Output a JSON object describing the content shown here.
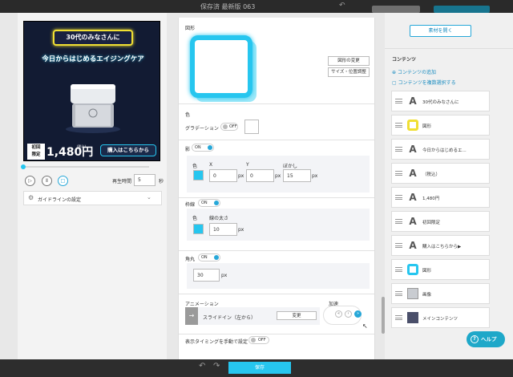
{
  "topbar": {
    "title": "保存済 最新版 063",
    "left_button": "",
    "right_button": ""
  },
  "banner": {
    "headline": "30代のみなさんに",
    "subline": "今日からはじめるエイジングケア",
    "badge_line1": "初回",
    "badge_line2": "限定",
    "price": "1,480円",
    "tax_note": "(税込)",
    "buy_button": "購入はこちらから"
  },
  "preview": {
    "progress": 0.02,
    "play_time_label": "再生時間",
    "play_time_value": "5",
    "play_time_unit": "秒",
    "guideline_label": "ガイドラインの設定"
  },
  "editor": {
    "shape_label": "図形",
    "change_shape": "図形の変更",
    "size_position": "サイズ・位置調整",
    "color_label": "色",
    "gradation_label": "グラデーション",
    "gradation_state": "OFF",
    "shadow_label": "影",
    "shadow_state": "ON",
    "shadow_color_label": "色",
    "shadow_x_label": "X",
    "shadow_y_label": "Y",
    "shadow_blur_label": "ぼかし",
    "shadow_x": "0",
    "shadow_y": "0",
    "shadow_blur": "15",
    "unit_px": "px",
    "border_label": "枠線",
    "border_state": "ON",
    "border_color_label": "色",
    "border_width_label": "線の太さ",
    "border_width": "10",
    "radius_label": "角丸",
    "radius_state": "ON",
    "radius_value": "30",
    "animation_label": "アニメーション",
    "animation_name": "スライドイン（左から）",
    "animation_change": "変更",
    "speed_label": "加速",
    "timing_label": "表示タイミングを手動で設定",
    "timing_state": "OFF",
    "accent_color": "#26c6ef"
  },
  "right": {
    "open_material": "素材を開く",
    "contents_title": "コンテンツ",
    "add_content": "コンテンツの追加",
    "add_multiple": "コンテンツを複数選択する",
    "items": [
      {
        "icon": "text-icon",
        "label": "30代のみなさんに"
      },
      {
        "icon": "shape-icon",
        "label": "図形"
      },
      {
        "icon": "text-icon",
        "label": "今日からはじめるエ..."
      },
      {
        "icon": "text-icon",
        "label": "（税込）"
      },
      {
        "icon": "text-icon",
        "label": "1,480円"
      },
      {
        "icon": "text-icon",
        "label": "初回限定"
      },
      {
        "icon": "text-icon",
        "label": "購入はこちらから▶"
      },
      {
        "icon": "shape-icon",
        "label": "図形"
      },
      {
        "icon": "image-icon",
        "label": "画像"
      },
      {
        "icon": "main-content-icon",
        "label": "メインコンテンツ"
      }
    ]
  },
  "bottombar": {
    "save": "保存"
  },
  "help": {
    "label": "ヘルプ"
  }
}
